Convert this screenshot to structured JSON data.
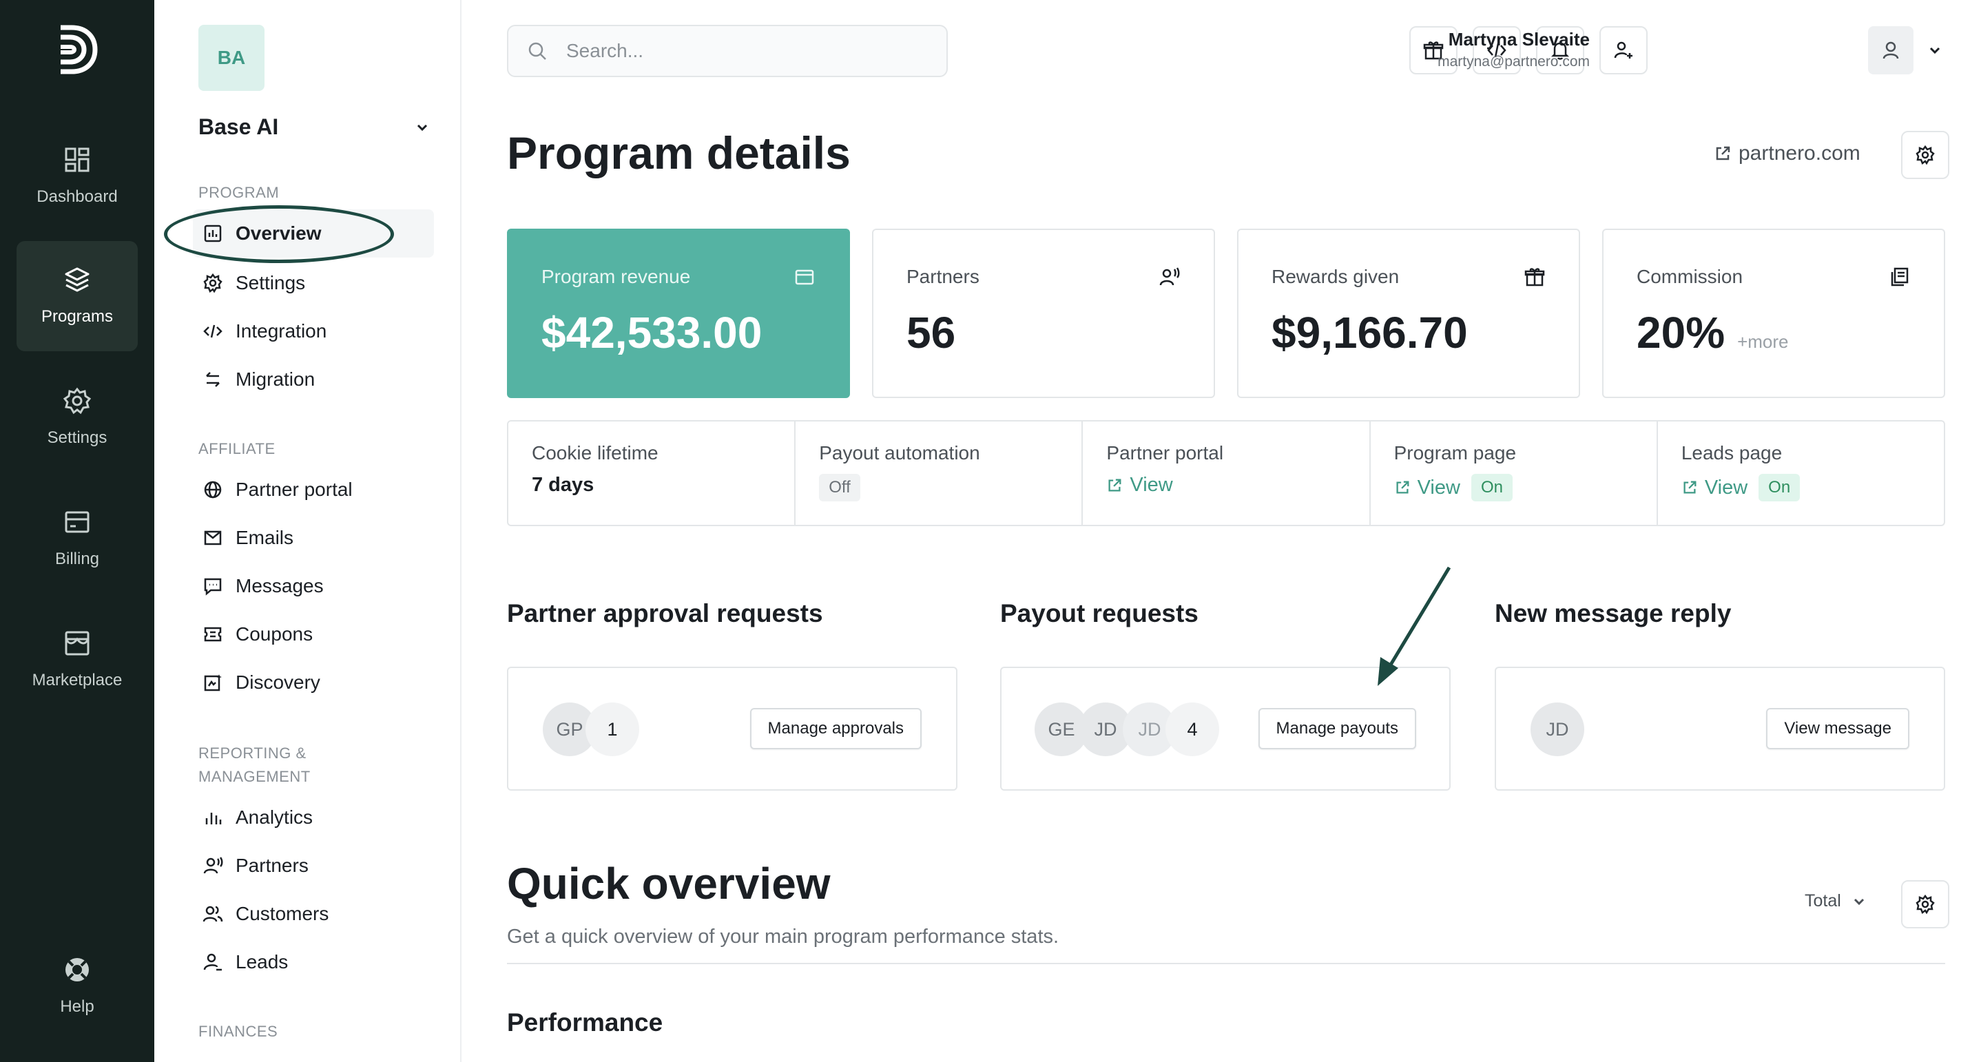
{
  "rail": {
    "items": [
      {
        "label": "Dashboard",
        "icon": "dashboard-icon"
      },
      {
        "label": "Programs",
        "icon": "layers-icon",
        "active": true
      },
      {
        "label": "Settings",
        "icon": "gear-icon"
      },
      {
        "label": "Billing",
        "icon": "billing-icon"
      },
      {
        "label": "Marketplace",
        "icon": "store-icon"
      }
    ],
    "help": "Help"
  },
  "sidebar": {
    "workspace_badge": "BA",
    "workspace_name": "Base AI",
    "sections": {
      "program": "PROGRAM",
      "affiliate": "AFFILIATE",
      "reporting_line1": "REPORTING &",
      "reporting_line2": "MANAGEMENT",
      "finances": "FINANCES"
    },
    "program_items": [
      "Overview",
      "Settings",
      "Integration",
      "Migration"
    ],
    "affiliate_items": [
      "Partner portal",
      "Emails",
      "Messages",
      "Coupons",
      "Discovery"
    ],
    "reporting_items": [
      "Analytics",
      "Partners",
      "Customers",
      "Leads"
    ]
  },
  "header": {
    "search_placeholder": "Search...",
    "user_name": "Martyna Slevaite",
    "user_email": "martyna@partnero.com"
  },
  "page": {
    "title": "Program details",
    "link": "partnero.com"
  },
  "stats": [
    {
      "label": "Program revenue",
      "value": "$42,533.00"
    },
    {
      "label": "Partners",
      "value": "56"
    },
    {
      "label": "Rewards given",
      "value": "$9,166.70"
    },
    {
      "label": "Commission",
      "value": "20%",
      "more": "+more"
    }
  ],
  "info": {
    "cookie_label": "Cookie lifetime",
    "cookie_value": "7 days",
    "payout_label": "Payout automation",
    "payout_value": "Off",
    "portal_label": "Partner portal",
    "portal_link": "View",
    "program_page_label": "Program page",
    "program_page_link": "View",
    "program_page_status": "On",
    "leads_page_label": "Leads page",
    "leads_page_link": "View",
    "leads_page_status": "On"
  },
  "requests": {
    "approval": {
      "title": "Partner approval requests",
      "avatars": [
        "GP"
      ],
      "count": "1",
      "button": "Manage approvals"
    },
    "payout": {
      "title": "Payout requests",
      "avatars": [
        "GE",
        "JD",
        "JD"
      ],
      "count": "4",
      "button": "Manage payouts"
    },
    "message": {
      "title": "New message reply",
      "avatars": [
        "JD"
      ],
      "button": "View message"
    }
  },
  "quick_overview": {
    "title": "Quick overview",
    "subtitle": "Get a quick overview of your main program performance stats.",
    "select_value": "Total",
    "performance": "Performance"
  },
  "colors": {
    "rail_bg": "#15211f",
    "accent_green": "#55b3a3",
    "annotation": "#1d4a42"
  }
}
